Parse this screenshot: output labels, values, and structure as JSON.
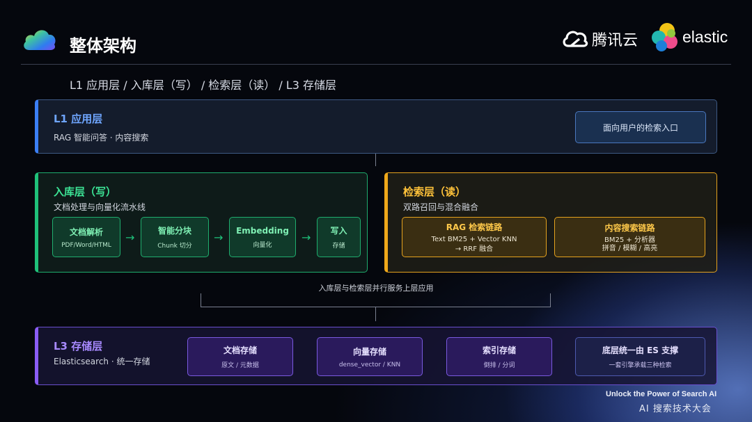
{
  "header": {
    "title": "整体架构",
    "subtitle": "L1 应用层 / 入库层（写） / 检索层（读） / L3 存储层",
    "brand_tencent": "腾讯云",
    "brand_elastic": "elastic"
  },
  "l1": {
    "title": "L1 应用层",
    "desc": "RAG 智能问答 · 内容搜索",
    "entry": "面向用户的检索入口"
  },
  "ingest": {
    "title": "入库层（写）",
    "desc": "文档处理与向量化流水线",
    "steps": [
      {
        "title": "文档解析",
        "sub": "PDF/Word/HTML"
      },
      {
        "title": "智能分块",
        "sub": "Chunk 切分"
      },
      {
        "title": "Embedding",
        "sub": "向量化"
      },
      {
        "title": "写入",
        "sub": "存储"
      }
    ],
    "arrow": "→"
  },
  "search": {
    "title": "检索层（读）",
    "desc": "双路召回与混合融合",
    "chains": [
      {
        "title": "RAG 检索链路",
        "line1": "Text BM25 + Vector KNN",
        "line2": "→ RRF 融合"
      },
      {
        "title": "内容搜索链路",
        "line1": "BM25 + 分析器",
        "line2": "拼音 / 模糊 / 高亮"
      }
    ]
  },
  "middle_note": "入库层与检索层并行服务上层应用",
  "l3": {
    "title": "L3 存储层",
    "desc": "Elasticsearch · 统一存储",
    "stores": [
      {
        "title": "文档存储",
        "sub": "原文 / 元数据"
      },
      {
        "title": "向量存储",
        "sub": "dense_vector / KNN"
      },
      {
        "title": "索引存储",
        "sub": "倒排 / 分词"
      },
      {
        "title": "底层统一由 ES 支撑",
        "sub": "一套引擎承载三种检索"
      }
    ]
  },
  "footer": {
    "tagline": "Unlock the Power of Search AI",
    "event": "AI 搜索技术大会"
  },
  "colors": {
    "l1_accent": "#3b7ff5",
    "ingest_accent": "#1fc17a",
    "search_accent": "#f0a81a",
    "l3_accent": "#8a5cf5"
  }
}
